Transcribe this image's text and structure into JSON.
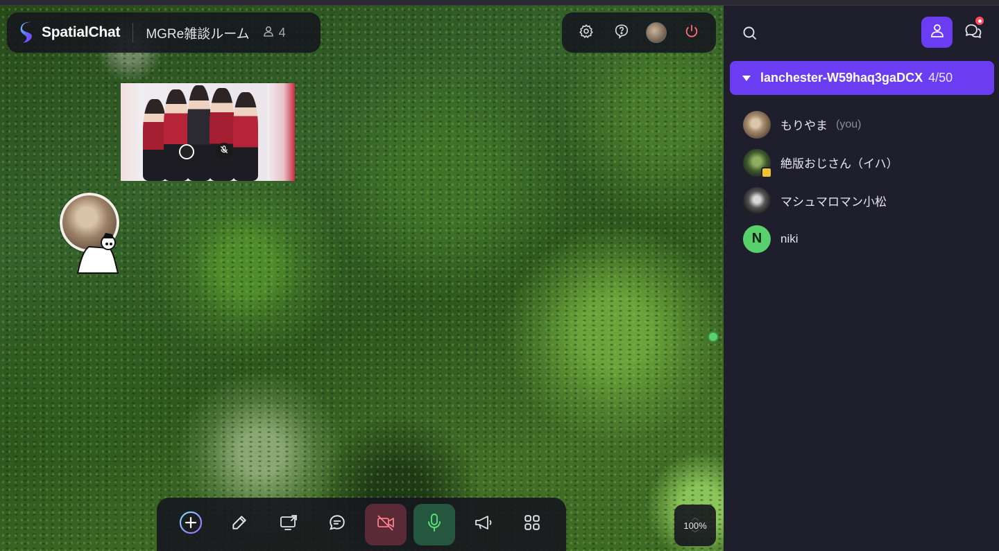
{
  "app": {
    "name": "SpatialChat",
    "room_title": "MGRe雑談ルーム",
    "participant_count": "4"
  },
  "canvas": {
    "zoom": "100%"
  },
  "toolbar": {
    "buttons": [
      "add",
      "draw",
      "share-screen",
      "chat",
      "camera-off",
      "microphone",
      "broadcast",
      "apps"
    ]
  },
  "sidebar": {
    "room_header": {
      "name": "lanchester-W59haq3gaDCX",
      "count": "4/50"
    },
    "members": [
      {
        "name": "もりやま",
        "suffix": "(you)",
        "avatar": "cat-photo"
      },
      {
        "name": "絶版おじさん（イハ）",
        "suffix": "",
        "avatar": "bird-photo"
      },
      {
        "name": "マシュマロマン小松",
        "suffix": "",
        "avatar": "bw-photo"
      },
      {
        "name": "niki",
        "suffix": "",
        "avatar": "letter-n",
        "initial": "N"
      }
    ]
  },
  "colors": {
    "accent": "#6a3df2",
    "panel_bg": "#1f1e2c",
    "mic_active": "#25573f",
    "cam_off": "#5a2b37",
    "online_green": "#58d16d",
    "notification": "#ff4b5c"
  }
}
